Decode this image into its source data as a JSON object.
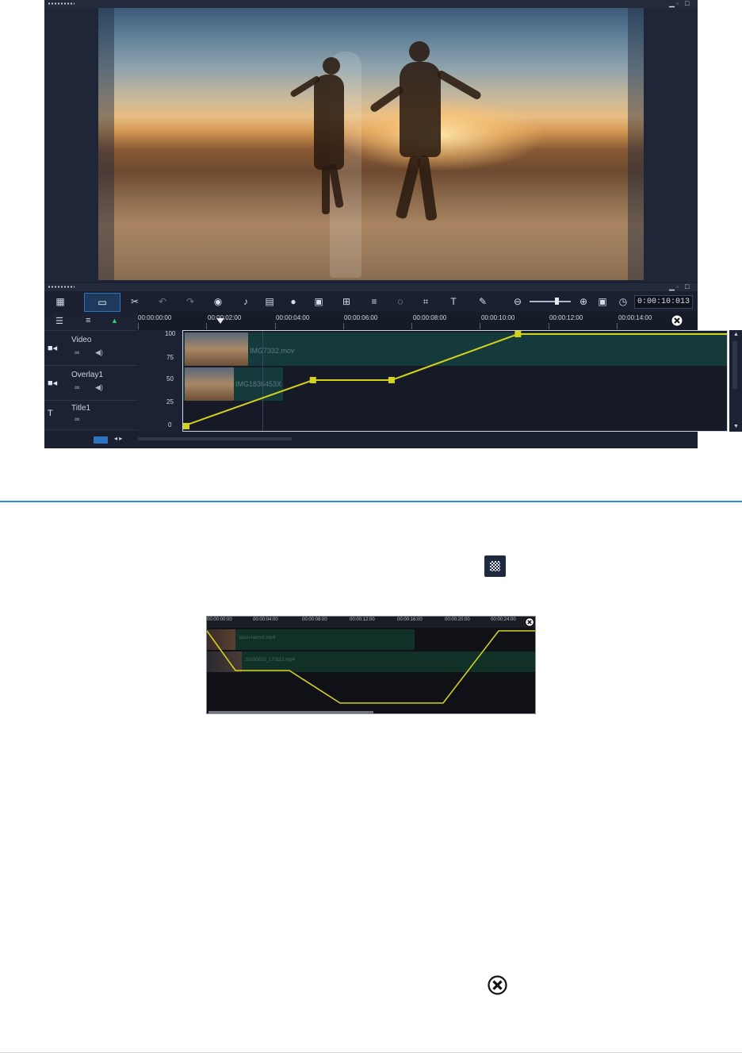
{
  "timeline": {
    "ruler_labels": [
      "00:00:00:00",
      "00:00:02:00",
      "00:00:04:00",
      "00:00:06:00",
      "00:00:08:00",
      "00:00:10:00",
      "00:00:12:00",
      "00:00:14:00"
    ],
    "timecode": "0:00:10:013",
    "y_axis_labels": [
      "100",
      "75",
      "50",
      "25",
      "0"
    ],
    "tracks": [
      {
        "name": "Video",
        "clip": "IMG7332.mov"
      },
      {
        "name": "Overlay1",
        "clip": "IMG1836453X"
      },
      {
        "name": "Title1"
      }
    ],
    "keyframes": [
      {
        "time_s": 0,
        "value": 0
      },
      {
        "time_s": 3.8,
        "value": 50
      },
      {
        "time_s": 6.1,
        "value": 50
      },
      {
        "time_s": 9.8,
        "value": 100
      },
      {
        "time_s": 16,
        "value": 100
      }
    ],
    "zoom_level": 0.62
  },
  "example_timeline": {
    "ruler_labels": [
      "00:00:00:00",
      "00:00:04:00",
      "00:00:08:00",
      "00:00:12:00",
      "00:00:16:00",
      "00:00:20:00",
      "00:00:24:00"
    ],
    "tracks": [
      {
        "clip": "sison-taonot.mp4"
      },
      {
        "clip": "20160820_173112.mp4"
      }
    ]
  },
  "icons": {
    "mask": "checkerboard-mask-icon",
    "close": "close-circle-icon"
  },
  "colors": {
    "accent": "#2b8fd6",
    "keyframe_line": "#d4d21c",
    "clip_fill": "#153a3c",
    "selected_button": "#1d3a5c"
  }
}
